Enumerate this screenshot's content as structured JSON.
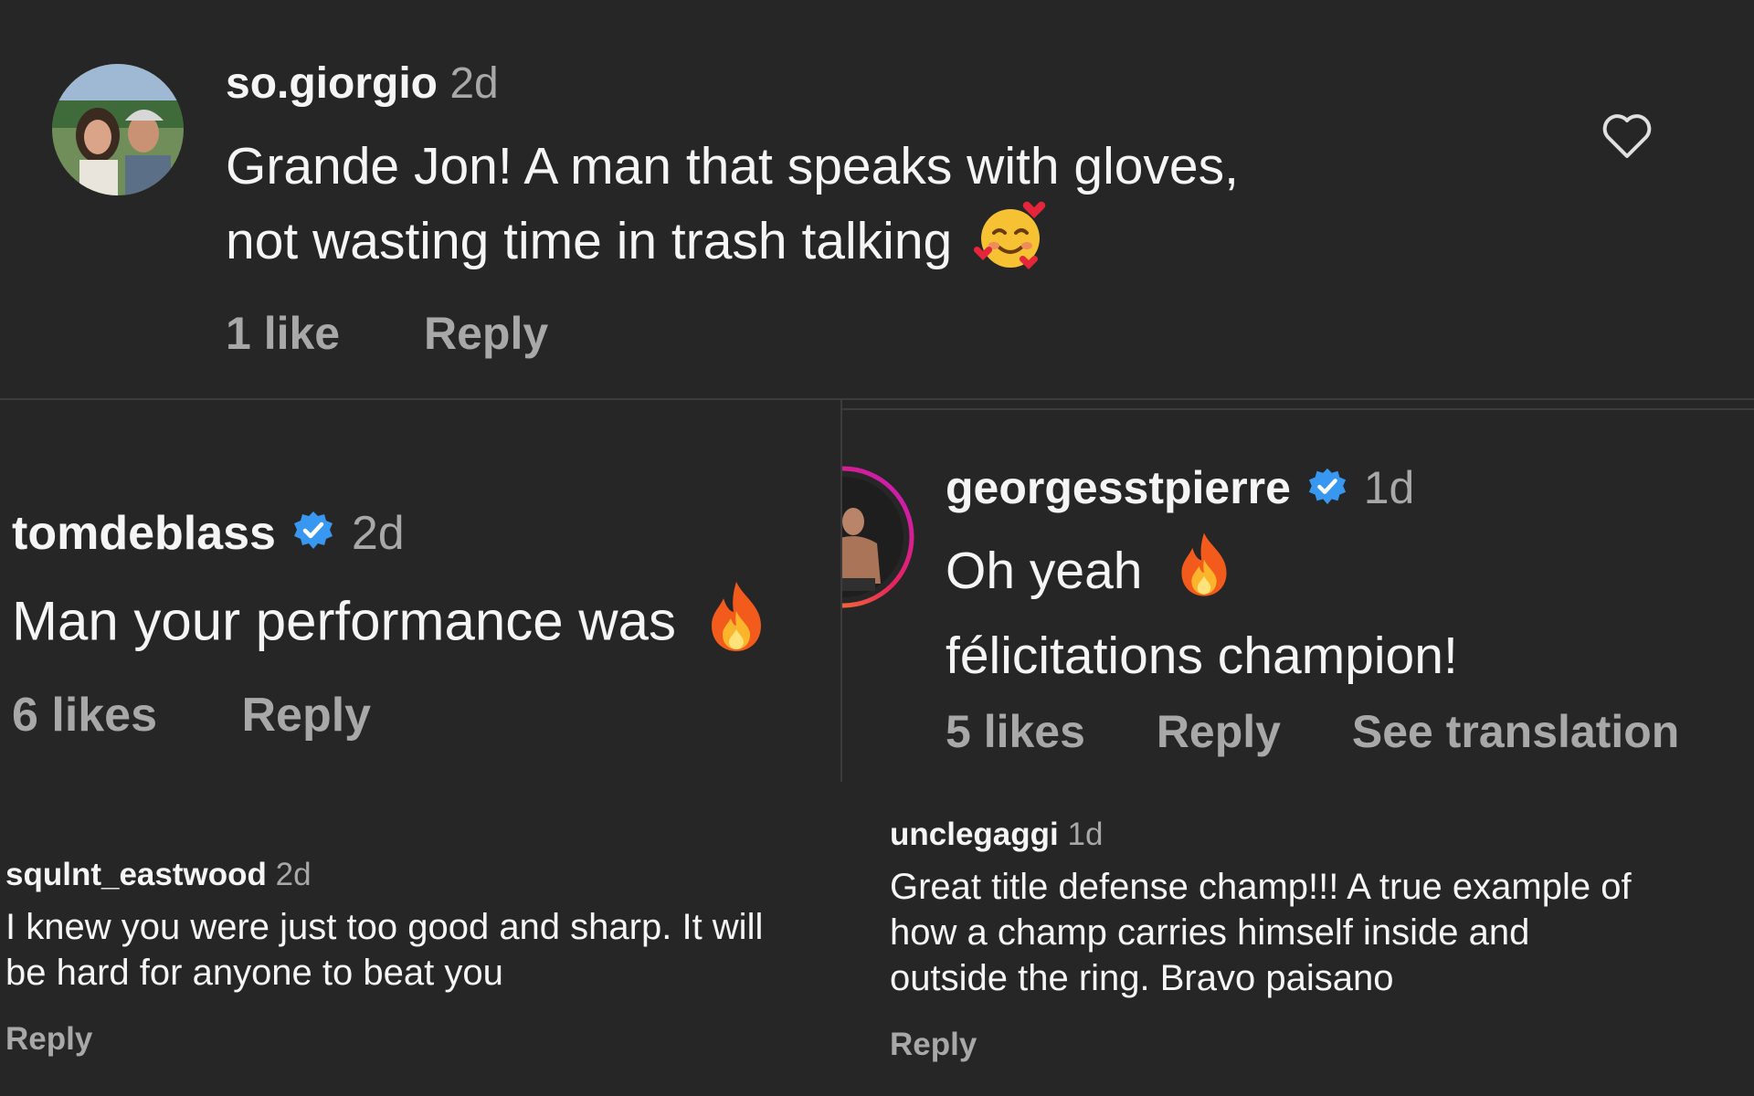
{
  "comments": [
    {
      "username": "so.giorgio",
      "time": "2d",
      "lines": [
        "Grande Jon! A man that speaks with gloves,",
        "not wasting time in trash talking"
      ],
      "emoji": "smiling-face-with-hearts",
      "likes": "1 like",
      "reply": "Reply"
    },
    {
      "username": "tomdeblass",
      "verified": true,
      "time": "2d",
      "text": "Man your performance was",
      "emoji": "fire",
      "likes": "6 likes",
      "reply": "Reply"
    },
    {
      "username": "georgesstpierre",
      "verified": true,
      "time": "1d",
      "lines": [
        "Oh yeah",
        "félicitations champion!"
      ],
      "emoji": "fire",
      "likes": "5 likes",
      "reply": "Reply",
      "translate": "See translation"
    },
    {
      "username": "squlnt_eastwood",
      "time": "2d",
      "lines": [
        "I knew you were just too good and sharp. It will",
        "be hard for anyone to beat you"
      ],
      "reply": "Reply"
    },
    {
      "username": "unclegaggi",
      "time": "1d",
      "lines": [
        "Great title defense champ!!! A true example of",
        "how a champ carries himself inside and",
        "outside the ring. Bravo paisano"
      ],
      "reply": "Reply"
    }
  ],
  "icons": {
    "heart": "heart-outline-icon",
    "verified": "verified-badge-icon",
    "fire": "fire-emoji",
    "hearts": "smiling-face-with-hearts-emoji"
  },
  "colors": {
    "background": "#262626",
    "text": "#f5f5f5",
    "muted": "#a8a8a8",
    "verified": "#3897f0"
  }
}
